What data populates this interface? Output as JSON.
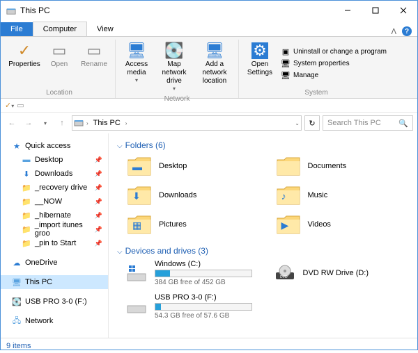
{
  "window": {
    "title": "This PC"
  },
  "tabs": {
    "file": "File",
    "computer": "Computer",
    "view": "View"
  },
  "ribbon": {
    "properties": "Properties",
    "open": "Open",
    "rename": "Rename",
    "access": "Access media",
    "mapdrive": "Map network drive",
    "addloc": "Add a network location",
    "opensettings": "Open Settings",
    "uninstall": "Uninstall or change a program",
    "sysprops": "System properties",
    "manage": "Manage",
    "grp_location": "Location",
    "grp_network": "Network",
    "grp_system": "System"
  },
  "address": {
    "path": "This PC",
    "search_placeholder": "Search This PC"
  },
  "nav": {
    "quick": "Quick access",
    "items": [
      {
        "label": "Desktop"
      },
      {
        "label": "Downloads"
      },
      {
        "label": "_recovery drive"
      },
      {
        "label": "__NOW"
      },
      {
        "label": "_hibernate"
      },
      {
        "label": "_import itunes groo"
      },
      {
        "label": "_pin to Start"
      }
    ],
    "onedrive": "OneDrive",
    "thispc": "This PC",
    "usb": "USB PRO 3-0 (F:)",
    "network": "Network"
  },
  "sections": {
    "folders": "Folders (6)",
    "drives": "Devices and drives (3)"
  },
  "folders": [
    {
      "name": "Desktop",
      "accent": "#2b7cd3"
    },
    {
      "name": "Documents",
      "accent": ""
    },
    {
      "name": "Downloads",
      "accent": "#2b7cd3"
    },
    {
      "name": "Music",
      "accent": "#2b7cd3"
    },
    {
      "name": "Pictures",
      "accent": "#2b7cd3"
    },
    {
      "name": "Videos",
      "accent": "#2b7cd3"
    }
  ],
  "drives": {
    "c": {
      "name": "Windows (C:)",
      "free": "384 GB free of 452 GB",
      "pct": 15
    },
    "d": {
      "name": "DVD RW Drive (D:)"
    },
    "f": {
      "name": "USB PRO 3-0 (F:)",
      "free": "54.3 GB free of 57.6 GB",
      "pct": 6
    }
  },
  "status": {
    "items": "9 items"
  }
}
